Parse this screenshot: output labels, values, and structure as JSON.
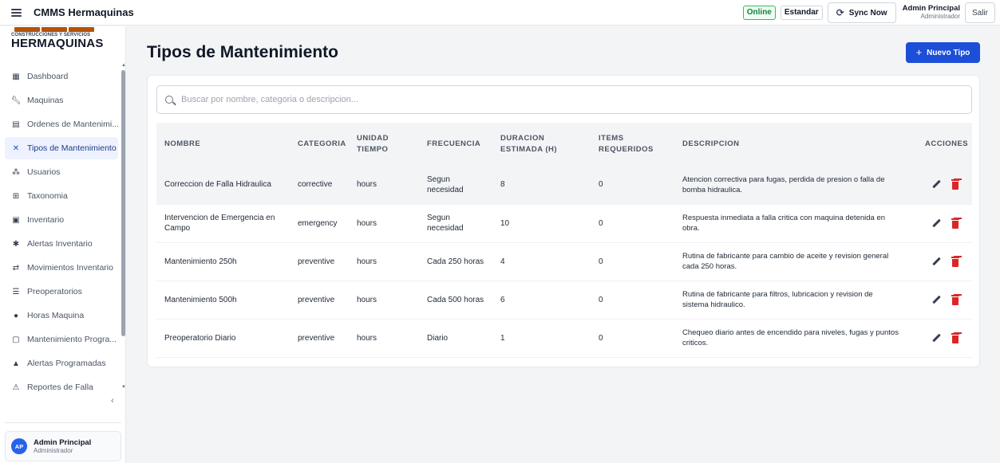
{
  "app": {
    "title": "CMMS Hermaquinas"
  },
  "topbar": {
    "online": "Online",
    "mode": "Estandar",
    "sync_label": "Sync Now",
    "user_name": "Admin Principal",
    "user_role": "Administrador",
    "exit_label": "Salir"
  },
  "logo": {
    "subtitle": "CONSTRUCCIONES Y SERVICIOS",
    "name": "HERMAQUINAS"
  },
  "sidebar": {
    "items": [
      {
        "label": "Dashboard",
        "icon": "dashboard-icon"
      },
      {
        "label": "Maquinas",
        "icon": "wrench-icon"
      },
      {
        "label": "Ordenes de Mantenimi...",
        "icon": "clipboard-icon"
      },
      {
        "label": "Tipos de Mantenimiento",
        "icon": "tools-icon",
        "active": true
      },
      {
        "label": "Usuarios",
        "icon": "users-icon"
      },
      {
        "label": "Taxonomia",
        "icon": "taxonomy-icon"
      },
      {
        "label": "Inventario",
        "icon": "inventory-icon"
      },
      {
        "label": "Alertas Inventario",
        "icon": "alert-icon"
      },
      {
        "label": "Movimientos Inventario",
        "icon": "swap-icon"
      },
      {
        "label": "Preoperatorios",
        "icon": "checklist-icon"
      },
      {
        "label": "Horas Maquina",
        "icon": "clock-icon"
      },
      {
        "label": "Mantenimiento Progra...",
        "icon": "calendar-icon"
      },
      {
        "label": "Alertas Programadas",
        "icon": "bell-icon"
      },
      {
        "label": "Reportes de Falla",
        "icon": "warning-icon"
      }
    ],
    "user": {
      "initials": "AP",
      "name": "Admin Principal",
      "role": "Administrador"
    }
  },
  "main": {
    "title": "Tipos de Mantenimiento",
    "new_button": "Nuevo Tipo",
    "search_placeholder": "Buscar por nombre, categoria o descripcion..."
  },
  "table": {
    "headers": {
      "nombre": "NOMBRE",
      "categoria": "CATEGORIA",
      "unidad": "UNIDAD TIEMPO",
      "frecuencia": "FRECUENCIA",
      "duracion": "DURACION ESTIMADA (H)",
      "items": "ITEMS REQUERIDOS",
      "descripcion": "DESCRIPCION",
      "acciones": "ACCIONES"
    },
    "rows": [
      {
        "nombre": "Correccion de Falla Hidraulica",
        "categoria": "corrective",
        "unidad": "hours",
        "frecuencia": "Segun necesidad",
        "duracion": "8",
        "items": "0",
        "descripcion": "Atencion correctiva para fugas, perdida de presion o falla de bomba hidraulica."
      },
      {
        "nombre": "Intervencion de Emergencia en Campo",
        "categoria": "emergency",
        "unidad": "hours",
        "frecuencia": "Segun necesidad",
        "duracion": "10",
        "items": "0",
        "descripcion": "Respuesta inmediata a falla critica con maquina detenida en obra."
      },
      {
        "nombre": "Mantenimiento 250h",
        "categoria": "preventive",
        "unidad": "hours",
        "frecuencia": "Cada 250 horas",
        "duracion": "4",
        "items": "0",
        "descripcion": "Rutina de fabricante para cambio de aceite y revision general cada 250 horas."
      },
      {
        "nombre": "Mantenimiento 500h",
        "categoria": "preventive",
        "unidad": "hours",
        "frecuencia": "Cada 500 horas",
        "duracion": "6",
        "items": "0",
        "descripcion": "Rutina de fabricante para filtros, lubricacion y revision de sistema hidraulico."
      },
      {
        "nombre": "Preoperatorio Diario",
        "categoria": "preventive",
        "unidad": "hours",
        "frecuencia": "Diario",
        "duracion": "1",
        "items": "0",
        "descripcion": "Chequeo diario antes de encendido para niveles, fugas y puntos criticos."
      }
    ]
  },
  "colors": {
    "accent": "#1d4ed8",
    "online": "#22c55e",
    "delete": "#dc2626"
  }
}
